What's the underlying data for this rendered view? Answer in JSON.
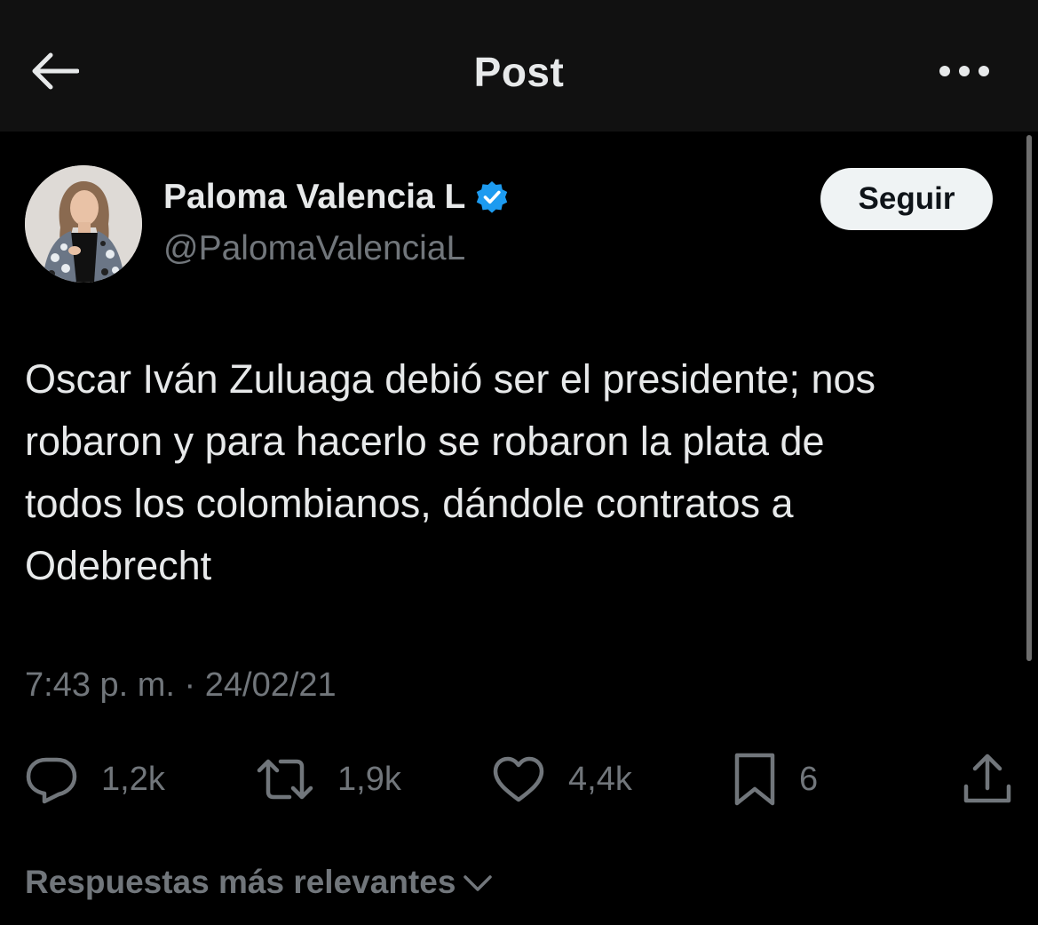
{
  "header": {
    "title": "Post",
    "back_icon": "arrow-left-icon",
    "more_icon": "more-horizontal-icon"
  },
  "author": {
    "name": "Paloma Valencia L",
    "handle": "@PalomaValenciaL",
    "verified_icon": "verified-badge-icon",
    "verified_color": "#1d9bf0"
  },
  "follow_button": {
    "label": "Seguir"
  },
  "tweet": {
    "text": "Oscar Iván Zuluaga debió ser el presidente; nos\nrobaron y para hacerlo se robaron la plata de\ntodos los colombianos, dándole contratos a\nOdebrecht",
    "timestamp": "7:43 p. m. · 24/02/21"
  },
  "actions": {
    "reply": {
      "icon": "reply-icon",
      "count": "1,2k"
    },
    "repost": {
      "icon": "repost-icon",
      "count": "1,9k"
    },
    "like": {
      "icon": "heart-icon",
      "count": "4,4k"
    },
    "bookmark": {
      "icon": "bookmark-icon",
      "count": "6"
    },
    "share": {
      "icon": "share-icon"
    }
  },
  "replies_sort": {
    "label": "Respuestas más relevantes",
    "icon": "chevron-down-icon"
  },
  "colors": {
    "background": "#000000",
    "header_background": "#111111",
    "primary_text": "#e7e9ea",
    "secondary_text": "#71767b",
    "follow_button_bg": "#eff3f4",
    "follow_button_text": "#0f1419"
  }
}
